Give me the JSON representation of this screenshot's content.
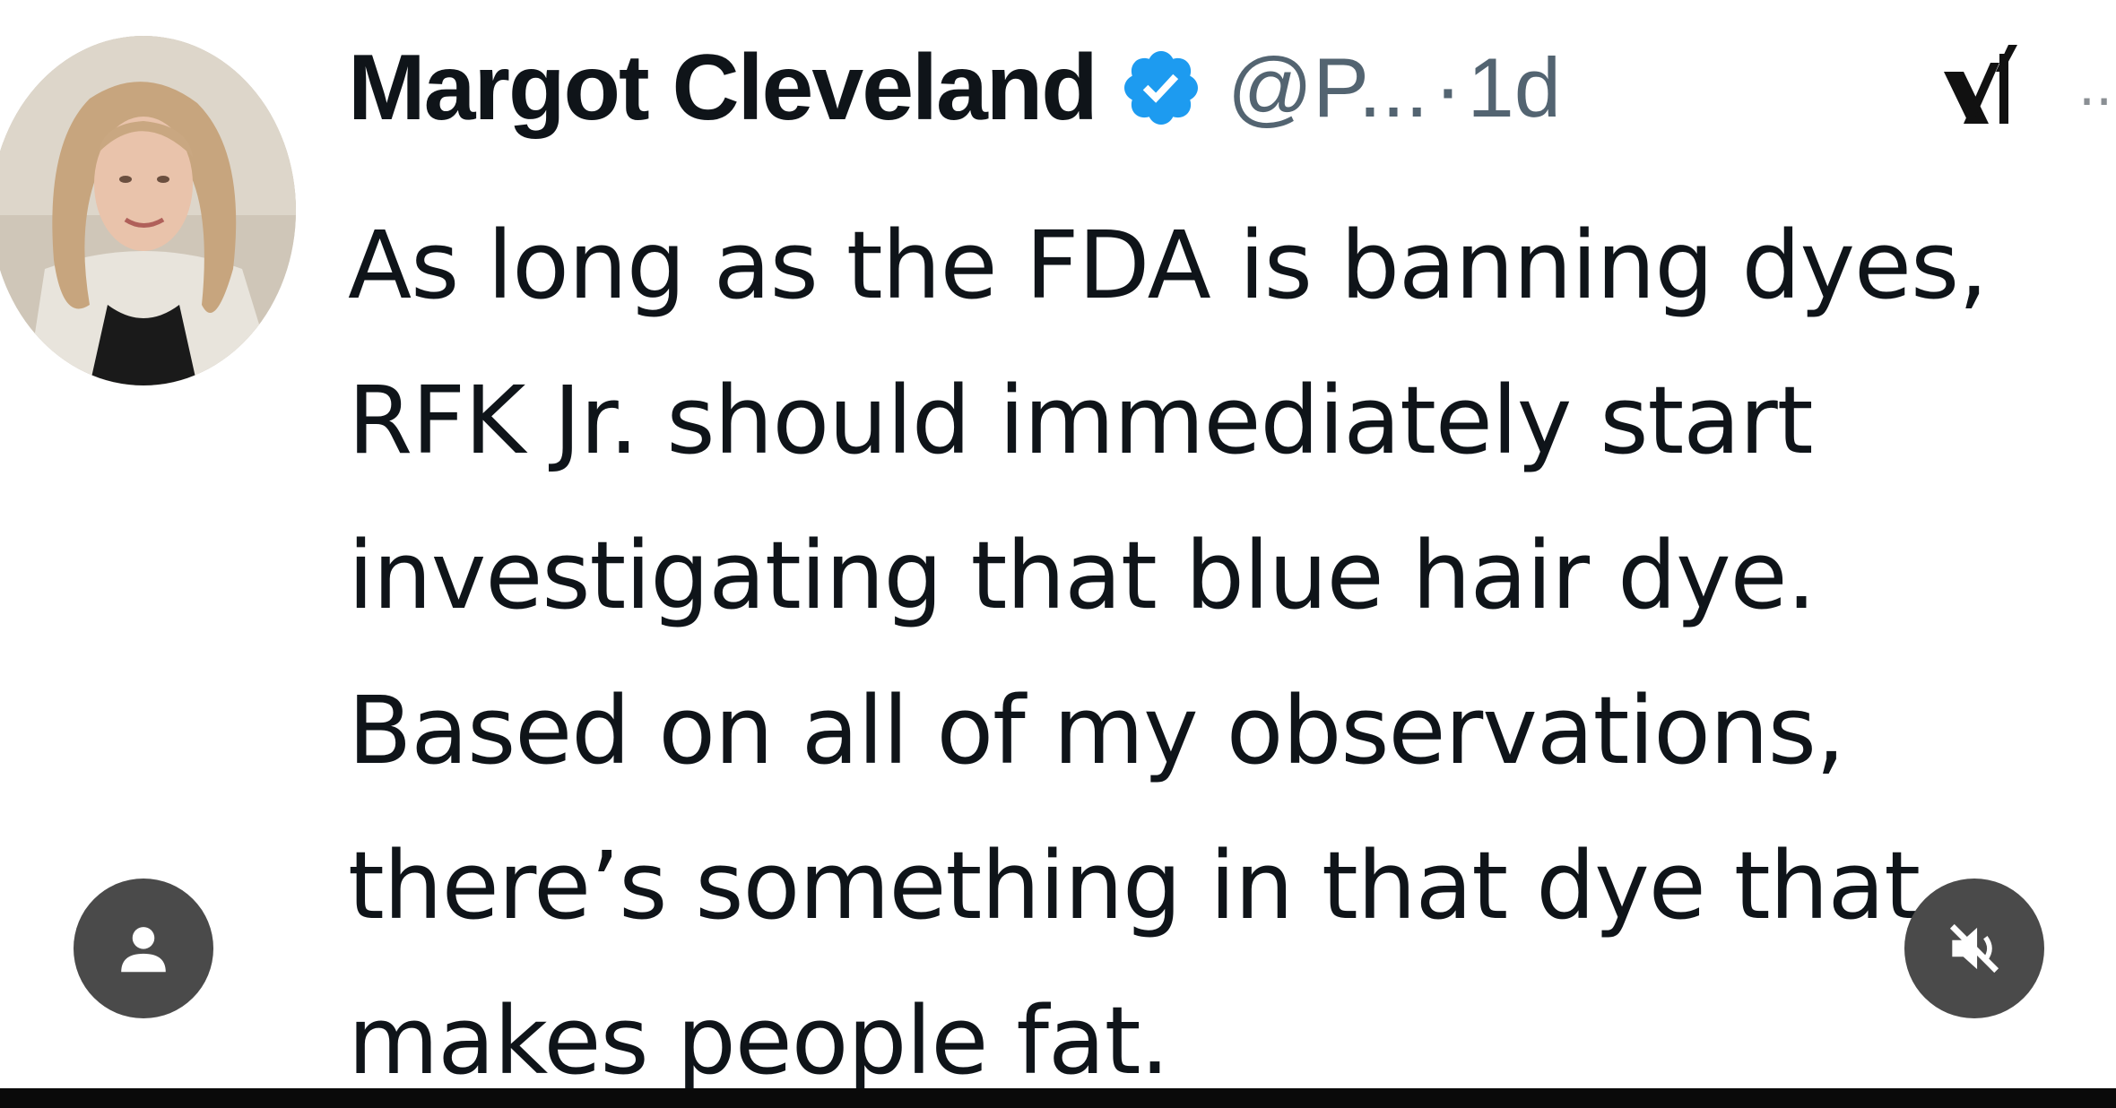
{
  "post": {
    "author": {
      "display_name": "Margot Cleveland",
      "handle": "@P...",
      "verified": true
    },
    "separator": "·",
    "timestamp": "1d",
    "body_lines": [
      "As long as the FDA is banning dyes,",
      "RFK Jr. should immediately start",
      "investigating that blue hair dye.",
      "Based on all of my observations,",
      "there’s something in that dye that",
      "makes people fat."
    ]
  },
  "icons": {
    "verified": "verified-badge-icon",
    "platform": "x-logo-icon",
    "more": "more-dots-icon",
    "user": "user-icon",
    "mute": "speaker-muted-icon"
  },
  "colors": {
    "text_primary": "#0f1419",
    "text_secondary": "#536471",
    "verified_blue": "#1d9bf0",
    "overlay_button": "#4a4a4a"
  }
}
